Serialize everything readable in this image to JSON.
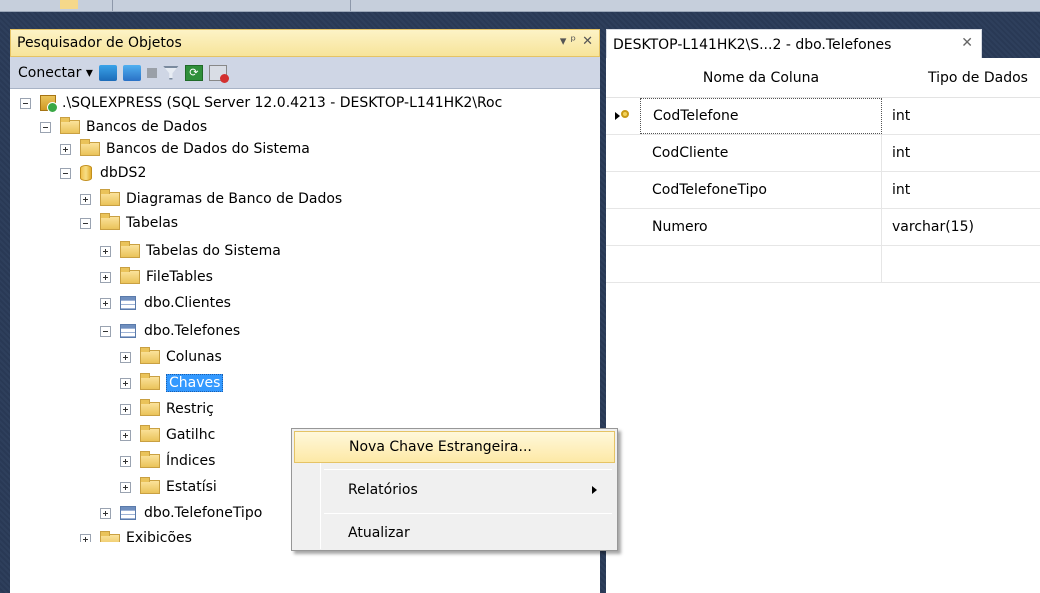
{
  "explorer": {
    "title": "Pesquisador de Objetos",
    "pin_glyph": "▾ ᵖ",
    "close_glyph": "✕",
    "toolbar": {
      "connect_label": "Conectar",
      "dropdown_glyph": "▾",
      "icons": [
        "connect-icon",
        "disconnect-icon",
        "stop-icon",
        "filter-icon",
        "refresh-icon",
        "activity-monitor-icon"
      ]
    },
    "tree": {
      "server": ".\\SQLEXPRESS (SQL Server 12.0.4213 - DESKTOP-L141HK2\\Roc",
      "databases": "Bancos de Dados",
      "system_databases": "Bancos de Dados do Sistema",
      "db": "dbDS2",
      "diagrams": "Diagramas de Banco de Dados",
      "tables": "Tabelas",
      "system_tables": "Tabelas do Sistema",
      "file_tables": "FileTables",
      "clientes": "dbo.Clientes",
      "telefones": "dbo.Telefones",
      "colunas": "Colunas",
      "chaves": "Chaves",
      "restricoes": "Restriç",
      "gatilhos": "Gatilhc",
      "indices": "Índices",
      "estatisticas": "Estatísi",
      "telefone_tipo": "dbo.TelefoneTipo",
      "exibicoes": "Exibições"
    }
  },
  "document": {
    "tab_title": "DESKTOP-L141HK2\\S...2 - dbo.Telefones",
    "close_glyph": "✕",
    "columns_header": "Nome da Coluna",
    "types_header": "Tipo de Dados",
    "rows": [
      {
        "name": "CodTelefone",
        "type": "int",
        "key": true
      },
      {
        "name": "CodCliente",
        "type": "int"
      },
      {
        "name": "CodTelefoneTipo",
        "type": "int"
      },
      {
        "name": "Numero",
        "type": "varchar(15)"
      }
    ]
  },
  "context_menu": {
    "new_foreign_key": "Nova Chave Estrangeira...",
    "reports": "Relatórios",
    "refresh": "Atualizar"
  }
}
